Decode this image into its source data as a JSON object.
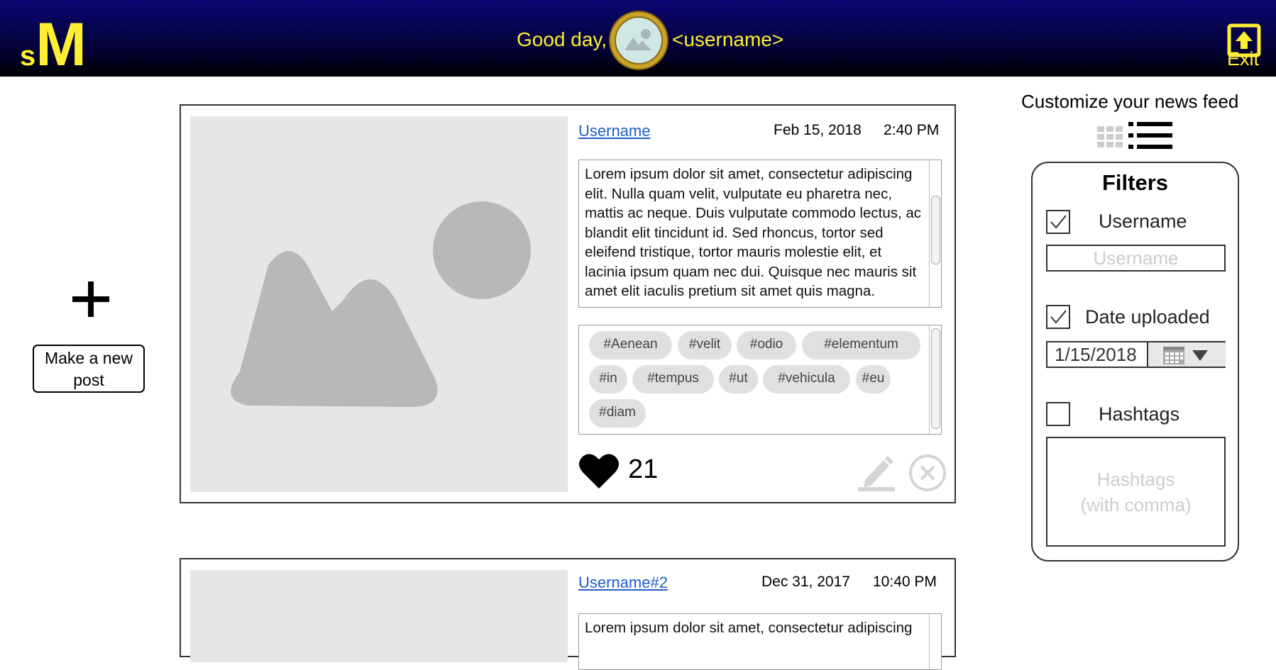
{
  "header": {
    "logo_small": "s",
    "logo_big": "M",
    "greeting": "Good day,",
    "username": "<username>",
    "exit_label": "Exit"
  },
  "colors": {
    "accent": "#ffef33",
    "header_bg": "#05033f",
    "link": "#1f5ec7"
  },
  "new_post": {
    "label": "Make a new post",
    "icon": "plus-icon"
  },
  "posts": [
    {
      "user": "Username",
      "date": "Feb 15, 2018",
      "time": "2:40 PM",
      "text": "Lorem ipsum dolor sit amet, consectetur adipiscing elit. Nulla quam velit, vulputate eu pharetra nec, mattis ac neque. Duis vulputate commodo lectus, ac blandit elit tincidunt id. Sed rhoncus, tortor sed eleifend tristique, tortor mauris molestie elit, et lacinia ipsum quam nec dui. Quisque nec mauris sit amet elit iaculis pretium sit amet quis magna.",
      "tags": [
        "#Aenean",
        "#velit",
        "#odio",
        "#elementum",
        "#in",
        "#tempus",
        "#ut",
        "#vehicula",
        "#eu",
        "#diam"
      ],
      "likes": "21"
    },
    {
      "user": "Username#2",
      "date": "Dec 31, 2017",
      "time": "10:40 PM",
      "text": "Lorem ipsum dolor sit amet, consectetur adipiscing"
    }
  ],
  "sidebar": {
    "title": "Customize your news feed",
    "filters": {
      "title": "Filters",
      "username": {
        "label": "Username",
        "checked": true,
        "placeholder": "Username"
      },
      "date": {
        "label": "Date uploaded",
        "checked": true,
        "value": "1/15/2018"
      },
      "hashtags": {
        "label": "Hashtags",
        "checked": false,
        "placeholder_line1": "Hashtags",
        "placeholder_line2": "(with comma)"
      }
    }
  }
}
